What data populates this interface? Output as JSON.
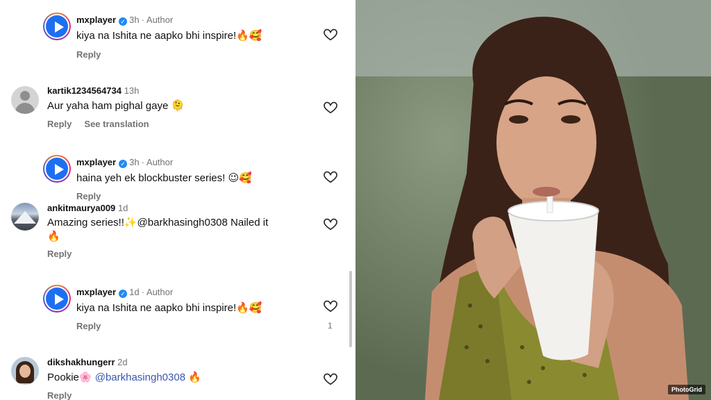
{
  "comments": [
    {
      "username": "mxplayer",
      "verified": true,
      "time": "3h",
      "author": "Author",
      "text": "kiya na Ishita ne aapko bhi inspire!🔥🥰",
      "reply": "Reply"
    },
    {
      "username": "kartik1234564734",
      "time": "13h",
      "text": "Aur yaha ham pighal gaye 🫠",
      "reply": "Reply",
      "translate": "See translation"
    },
    {
      "username": "mxplayer",
      "verified": true,
      "time": "3h",
      "author": "Author",
      "text": "haina yeh ek blockbuster series! 😉🥰",
      "reply": "Reply"
    },
    {
      "username": "ankitmaurya009",
      "time": "1d",
      "text_line1": "Amazing series!!✨@barkhasingh0308 Nailed it",
      "text_line2": "🔥",
      "reply": "Reply"
    },
    {
      "username": "mxplayer",
      "verified": true,
      "time": "1d",
      "author": "Author",
      "text": "kiya na Ishita ne aapko bhi inspire!🔥🥰",
      "reply": "Reply",
      "likes": "1"
    },
    {
      "username": "dikshakhungerr",
      "time": "2d",
      "text_prefix": "Pookie🌸 ",
      "mention": "@barkhasingh0308",
      "text_suffix": " 🔥",
      "reply": "Reply"
    }
  ],
  "photo": {
    "watermark": "PhotoGrid"
  },
  "icons": {
    "verified": "verified-badge-icon",
    "like": "heart-outline-icon"
  }
}
